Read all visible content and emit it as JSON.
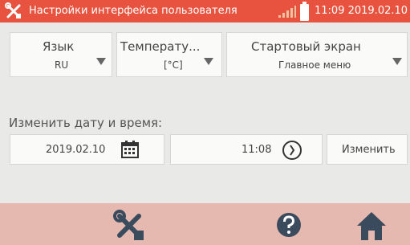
{
  "titlebar": {
    "title": "Настройки интерфейса пользователя",
    "time": "11:09 2019.02.10",
    "accent_color": "#e8533f",
    "icons": [
      "tools-icon",
      "signal-icon",
      "battery-icon"
    ]
  },
  "settings": {
    "language": {
      "label": "Язык",
      "value": "RU"
    },
    "temperature": {
      "label": "Температу...",
      "value": "[°C]"
    },
    "start_screen": {
      "label": "Стартовый экран",
      "value": "Главное меню"
    }
  },
  "datetime": {
    "section_label": "Изменить дату и время:",
    "date": "2019.02.10",
    "time": "11:08",
    "change_label": "Изменить"
  },
  "bottom_nav": {
    "icons": [
      "tools-icon",
      "help-icon",
      "home-icon"
    ]
  }
}
